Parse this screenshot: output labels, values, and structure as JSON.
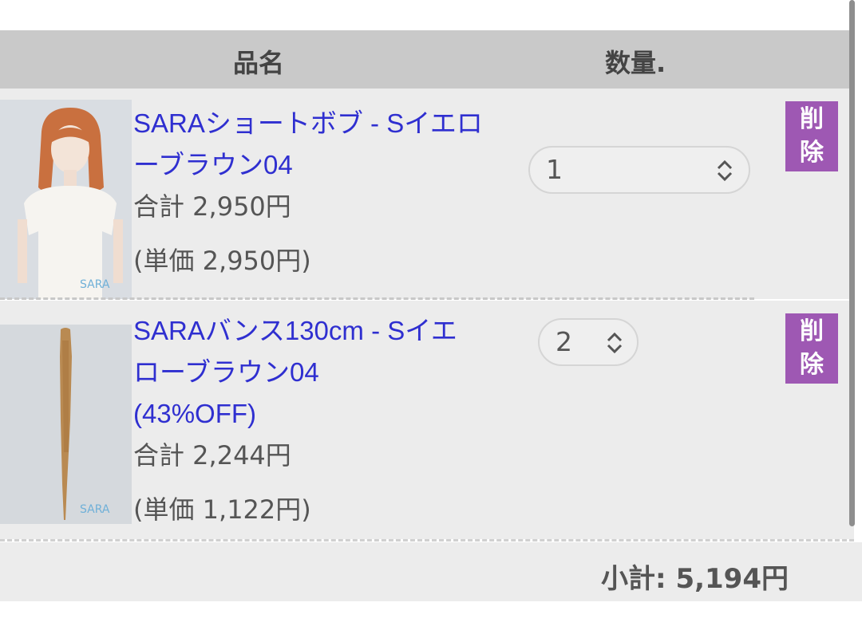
{
  "header": {
    "col_name": "品名",
    "col_qty": "数量."
  },
  "items": [
    {
      "title_line1": "SARAショートボブ - Sイエロ",
      "title_line2": "ーブラウン04",
      "total": "合計 2,950円",
      "unit_price": "(単価 2,950円)",
      "quantity": "1",
      "delete_line1": "削",
      "delete_line2": "除"
    },
    {
      "title_line1": "SARAバンス130cm - Sイエ",
      "title_line2": "ローブラウン04",
      "title_line3": "(43%OFF)",
      "total": "合計 2,244円",
      "unit_price": "(単価 1,122円)",
      "quantity": "2",
      "delete_line1": "削",
      "delete_line2": "除"
    }
  ],
  "footer": {
    "subtotal": "小計: 5,194円"
  },
  "colors": {
    "link": "#2f2fd0",
    "delete_bg": "#9e58b3",
    "header_bg": "#c9c9c9"
  }
}
